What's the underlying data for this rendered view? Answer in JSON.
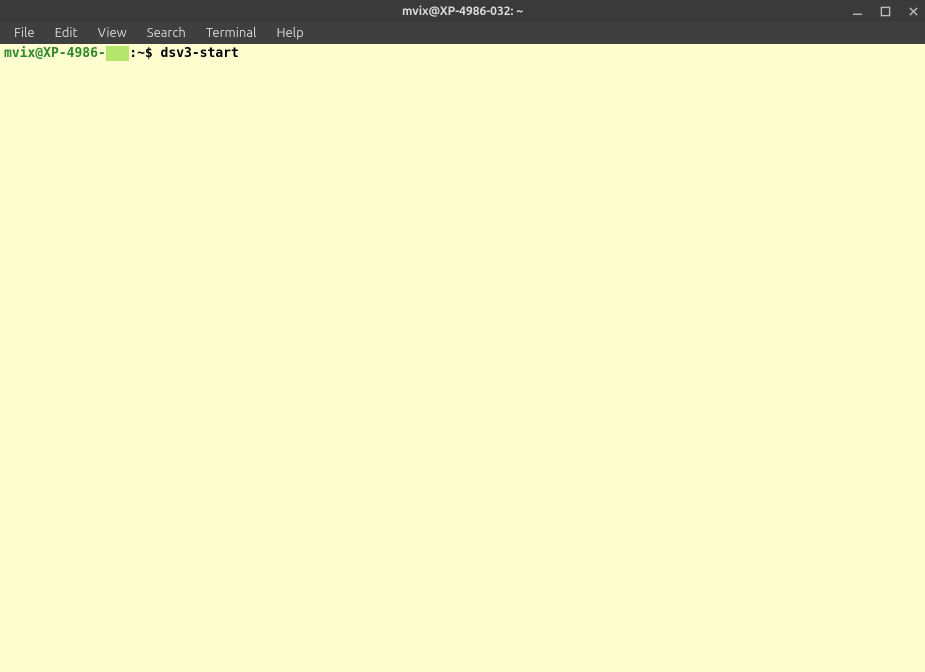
{
  "window": {
    "title": "mvix@XP-4986-032: ~"
  },
  "menubar": {
    "items": [
      "File",
      "Edit",
      "View",
      "Search",
      "Terminal",
      "Help"
    ]
  },
  "terminal": {
    "prompt": {
      "userhost_pre": "mvix@XP-4986-",
      "userhost_highlight": "   ",
      "path": "~",
      "symbol": "$"
    },
    "command": "dsv3-start"
  }
}
